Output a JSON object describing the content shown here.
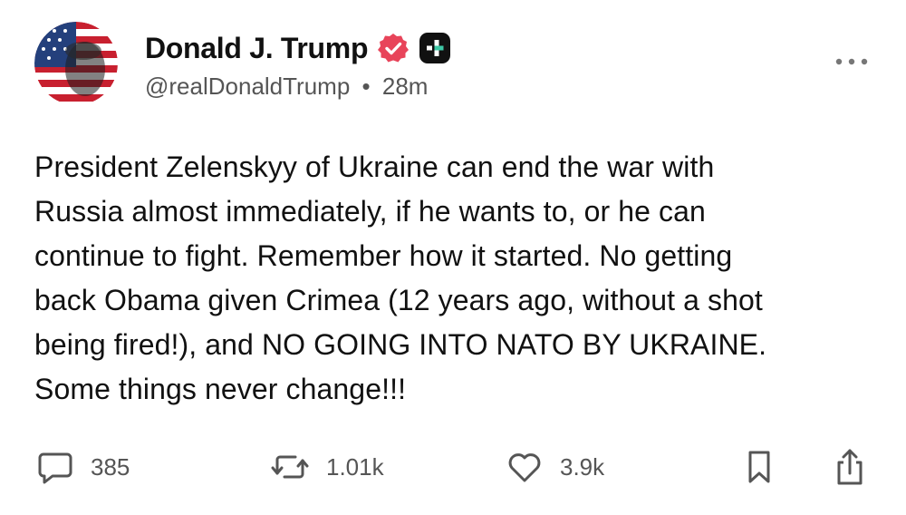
{
  "post": {
    "author": {
      "display_name": "Donald J. Trump",
      "handle": "@realDonaldTrump",
      "separator": "•",
      "time_ago": "28m",
      "verified_icon": "verified-badge-icon",
      "platform_icon": "truth-social-icon",
      "verified_color": "#e8445a"
    },
    "text_lines": [
      "President Zelenskyy of Ukraine can end the war with",
      "Russia almost immediately, if he wants to, or he can",
      "continue to fight. Remember how it started. No getting",
      "back Obama given Crimea (12 years ago, without a shot",
      "being fired!), and NO GOING INTO NATO BY UKRAINE.",
      "Some things never change!!!"
    ],
    "actions": {
      "replies": "385",
      "retruths": "1.01k",
      "likes": "3.9k"
    }
  }
}
